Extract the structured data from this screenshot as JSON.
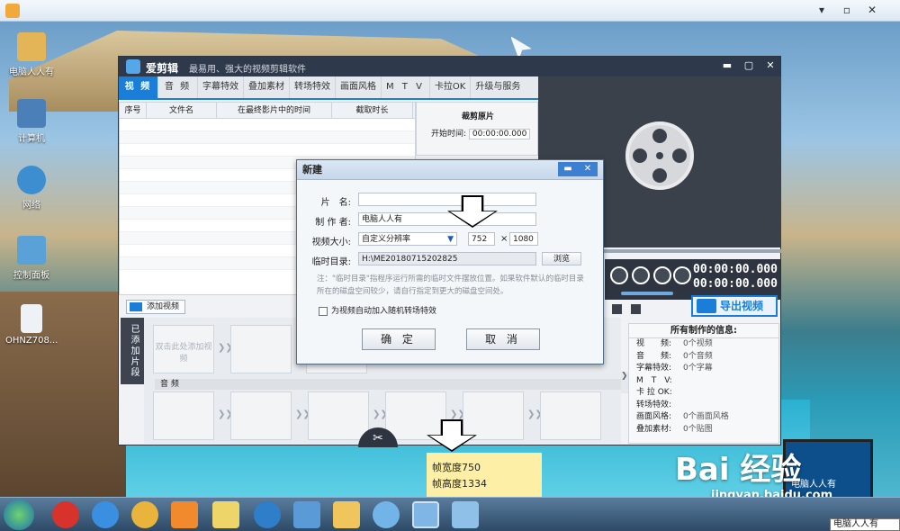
{
  "desktop": {
    "icons": [
      {
        "label": "电脑人人有",
        "icon": "user-folder-icon"
      },
      {
        "label": "计算机",
        "icon": "computer-icon"
      },
      {
        "label": "网络",
        "icon": "network-icon"
      },
      {
        "label": "控制面板",
        "icon": "control-panel-icon"
      },
      {
        "label": "OHNZ708...",
        "icon": "file-icon"
      }
    ]
  },
  "app": {
    "name": "爱剪辑",
    "slogan": "最易用、强大的视频剪辑软件",
    "tabs": [
      "视 频",
      "音 频",
      "字幕特效",
      "叠加素材",
      "转场特效",
      "画面风格",
      "M T V",
      "卡拉OK",
      "升级与服务"
    ],
    "list_headers": [
      "序号",
      "文件名",
      "在最终影片中的时间",
      "截取时长"
    ],
    "cut_panel": {
      "title": "裁剪原片",
      "start_label": "开始时间:",
      "start_value": "00:00:00.000"
    },
    "player": {
      "time1": "00:00:00.000",
      "time2": "00:00:00.000"
    },
    "export_label": "导出视频",
    "add_video_label": "添加视频",
    "added_clips_label": "已添加片段",
    "placeholder_slot": "双击此处添加视频",
    "audio_label": "音 频",
    "info": {
      "title": "所有制作的信息:",
      "rows": [
        {
          "k": "视　　频:",
          "v": "0个视频"
        },
        {
          "k": "音　　频:",
          "v": "0个音频"
        },
        {
          "k": "字幕特效:",
          "v": "0个字幕"
        },
        {
          "k": "M　T　V:",
          "v": ""
        },
        {
          "k": "卡 拉 OK:",
          "v": ""
        },
        {
          "k": "转场特效:",
          "v": ""
        },
        {
          "k": "画面风格:",
          "v": "0个画面风格"
        },
        {
          "k": "叠加素材:",
          "v": "0个贴图"
        }
      ]
    }
  },
  "dialog": {
    "title": "新建",
    "name_label": "片　名:",
    "name_value": "",
    "author_label": "制 作 者:",
    "author_value": "电脑人人有",
    "size_label": "视频大小:",
    "size_select": "自定义分辨率",
    "width": "752",
    "times": "×",
    "height": "1080",
    "tmp_label": "临时目录:",
    "tmp_value": "H:\\ME20180715202825",
    "browse_label": "浏览",
    "note": "注：\"临时目录\"指程序运行所需的临时文件摆放位置。如果软件默认的临时目录所在的磁盘空间较少，请自行指定到更大的磁盘空间处。",
    "checkbox_label": "为视频自动加入随机转场特效",
    "ok_label": "确 定",
    "cancel_label": "取 消"
  },
  "annotation": {
    "line1": "帧宽度750",
    "line2": "帧高度1334"
  },
  "taskbar": {
    "tooltip": "电脑人人有"
  },
  "watermark": {
    "brand": "Bai 经验",
    "url": "jingyan.baidu.com",
    "laptop_text": "电脑人人有"
  }
}
